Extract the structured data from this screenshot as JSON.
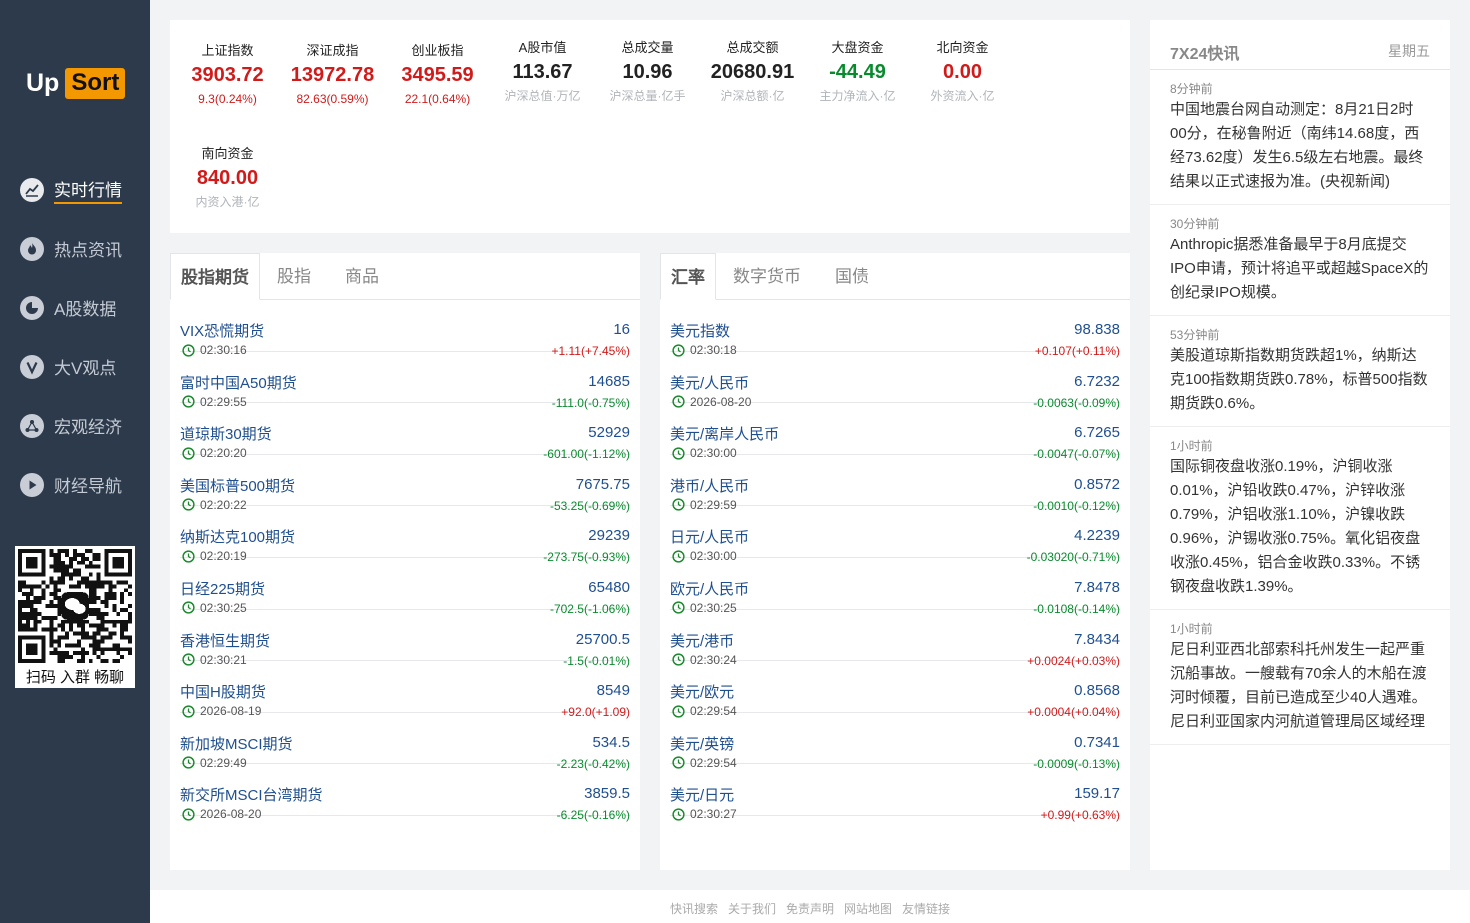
{
  "logo": {
    "part1": "Up",
    "part2": "Sort"
  },
  "nav": [
    {
      "label": "实时行情",
      "icon": "chart-icon",
      "active": true
    },
    {
      "label": "热点资讯",
      "icon": "fire-icon",
      "active": false
    },
    {
      "label": "A股数据",
      "icon": "pie-icon",
      "active": false
    },
    {
      "label": "大V观点",
      "icon": "v-icon",
      "active": false
    },
    {
      "label": "宏观经济",
      "icon": "globe-icon",
      "active": false
    },
    {
      "label": "财经导航",
      "icon": "play-icon",
      "active": false
    }
  ],
  "qr": {
    "caption": "扫码 入群 畅聊"
  },
  "indices": [
    {
      "name": "上证指数",
      "value": "3903.72",
      "sub": "9.3(0.24%)",
      "trend": "up"
    },
    {
      "name": "深证成指",
      "value": "13972.78",
      "sub": "82.63(0.59%)",
      "trend": "up"
    },
    {
      "name": "创业板指",
      "value": "3495.59",
      "sub": "22.1(0.64%)",
      "trend": "up"
    },
    {
      "name": "A股市值",
      "value": "113.67",
      "sub": "沪深总值·万亿",
      "trend": "neutral"
    },
    {
      "name": "总成交量",
      "value": "10.96",
      "sub": "沪深总量·亿手",
      "trend": "neutral"
    },
    {
      "name": "总成交额",
      "value": "20680.91",
      "sub": "沪深总额·亿",
      "trend": "neutral"
    },
    {
      "name": "大盘资金",
      "value": "-44.49",
      "sub": "主力净流入·亿",
      "trend": "down"
    },
    {
      "name": "北向资金",
      "value": "0.00",
      "sub": "外资流入·亿",
      "trend": "up"
    },
    {
      "name": "南向资金",
      "value": "840.00",
      "sub": "内资入港·亿",
      "trend": "up"
    }
  ],
  "futures": {
    "tabs": [
      "股指期货",
      "股指",
      "商品"
    ],
    "rows": [
      {
        "name": "VIX恐慌期货",
        "time": "02:30:16",
        "value": "16",
        "change": "+1.11(+7.45%)",
        "trend": "up"
      },
      {
        "name": "富时中国A50期货",
        "time": "02:29:55",
        "value": "14685",
        "change": "-111.0(-0.75%)",
        "trend": "down"
      },
      {
        "name": "道琼斯30期货",
        "time": "02:20:20",
        "value": "52929",
        "change": "-601.00(-1.12%)",
        "trend": "down"
      },
      {
        "name": "美国标普500期货",
        "time": "02:20:22",
        "value": "7675.75",
        "change": "-53.25(-0.69%)",
        "trend": "down"
      },
      {
        "name": "纳斯达克100期货",
        "time": "02:20:19",
        "value": "29239",
        "change": "-273.75(-0.93%)",
        "trend": "down"
      },
      {
        "name": "日经225期货",
        "time": "02:30:25",
        "value": "65480",
        "change": "-702.5(-1.06%)",
        "trend": "down"
      },
      {
        "name": "香港恒生期货",
        "time": "02:30:21",
        "value": "25700.5",
        "change": "-1.5(-0.01%)",
        "trend": "down"
      },
      {
        "name": "中国H股期货",
        "time": "2026-08-19",
        "value": "8549",
        "change": "+92.0(+1.09)",
        "trend": "up"
      },
      {
        "name": "新加坡MSCI期货",
        "time": "02:29:49",
        "value": "534.5",
        "change": "-2.23(-0.42%)",
        "trend": "down"
      },
      {
        "name": "新交所MSCI台湾期货",
        "time": "2026-08-20",
        "value": "3859.5",
        "change": "-6.25(-0.16%)",
        "trend": "down"
      }
    ]
  },
  "fx": {
    "tabs": [
      "汇率",
      "数字货币",
      "国债"
    ],
    "rows": [
      {
        "name": "美元指数",
        "time": "02:30:18",
        "value": "98.838",
        "change": "+0.107(+0.11%)",
        "trend": "up"
      },
      {
        "name": "美元/人民币",
        "time": "2026-08-20",
        "value": "6.7232",
        "change": "-0.0063(-0.09%)",
        "trend": "down"
      },
      {
        "name": "美元/离岸人民币",
        "time": "02:30:00",
        "value": "6.7265",
        "change": "-0.0047(-0.07%)",
        "trend": "down"
      },
      {
        "name": "港币/人民币",
        "time": "02:29:59",
        "value": "0.8572",
        "change": "-0.0010(-0.12%)",
        "trend": "down"
      },
      {
        "name": "日元/人民币",
        "time": "02:30:00",
        "value": "4.2239",
        "change": "-0.03020(-0.71%)",
        "trend": "down"
      },
      {
        "name": "欧元/人民币",
        "time": "02:30:25",
        "value": "7.8478",
        "change": "-0.0108(-0.14%)",
        "trend": "down"
      },
      {
        "name": "美元/港币",
        "time": "02:30:24",
        "value": "7.8434",
        "change": "+0.0024(+0.03%)",
        "trend": "up"
      },
      {
        "name": "美元/欧元",
        "time": "02:29:54",
        "value": "0.8568",
        "change": "+0.0004(+0.04%)",
        "trend": "up"
      },
      {
        "name": "美元/英镑",
        "time": "02:29:54",
        "value": "0.7341",
        "change": "-0.0009(-0.13%)",
        "trend": "down"
      },
      {
        "name": "美元/日元",
        "time": "02:30:27",
        "value": "159.17",
        "change": "+0.99(+0.63%)",
        "trend": "up"
      }
    ]
  },
  "news": {
    "title": "7X24快讯",
    "day": "星期五",
    "items": [
      {
        "time": "8分钟前",
        "text": "中国地震台网自动测定：8月21日2时00分，在秘鲁附近（南纬14.68度，西经73.62度）发生6.5级左右地震。最终结果以正式速报为准。(央视新闻)"
      },
      {
        "time": "30分钟前",
        "text": "Anthropic据悉准备最早于8月底提交IPO申请，预计将追平或超越SpaceX的创纪录IPO规模。"
      },
      {
        "time": "53分钟前",
        "text": "美股道琼斯指数期货跌超1%，纳斯达克100指数期货跌0.78%，标普500指数期货跌0.6%。"
      },
      {
        "time": "1小时前",
        "text": "国际铜夜盘收涨0.19%，沪铜收涨0.01%，沪铅收跌0.47%，沪锌收涨0.79%，沪铝收涨1.10%，沪镍收跌0.96%，沪锡收涨0.75%。氧化铝夜盘收涨0.45%，铝合金收跌0.33%。不锈钢夜盘收跌1.39%。"
      },
      {
        "time": "1小时前",
        "text": "尼日利亚西北部索科托州发生一起严重沉船事故。一艘载有70余人的木船在渡河时倾覆，目前已造成至少40人遇难。尼日利亚国家内河航道管理局区域经理"
      }
    ]
  },
  "footer": [
    "快讯搜索",
    "关于我们",
    "免责声明",
    "网站地图",
    "友情链接"
  ]
}
